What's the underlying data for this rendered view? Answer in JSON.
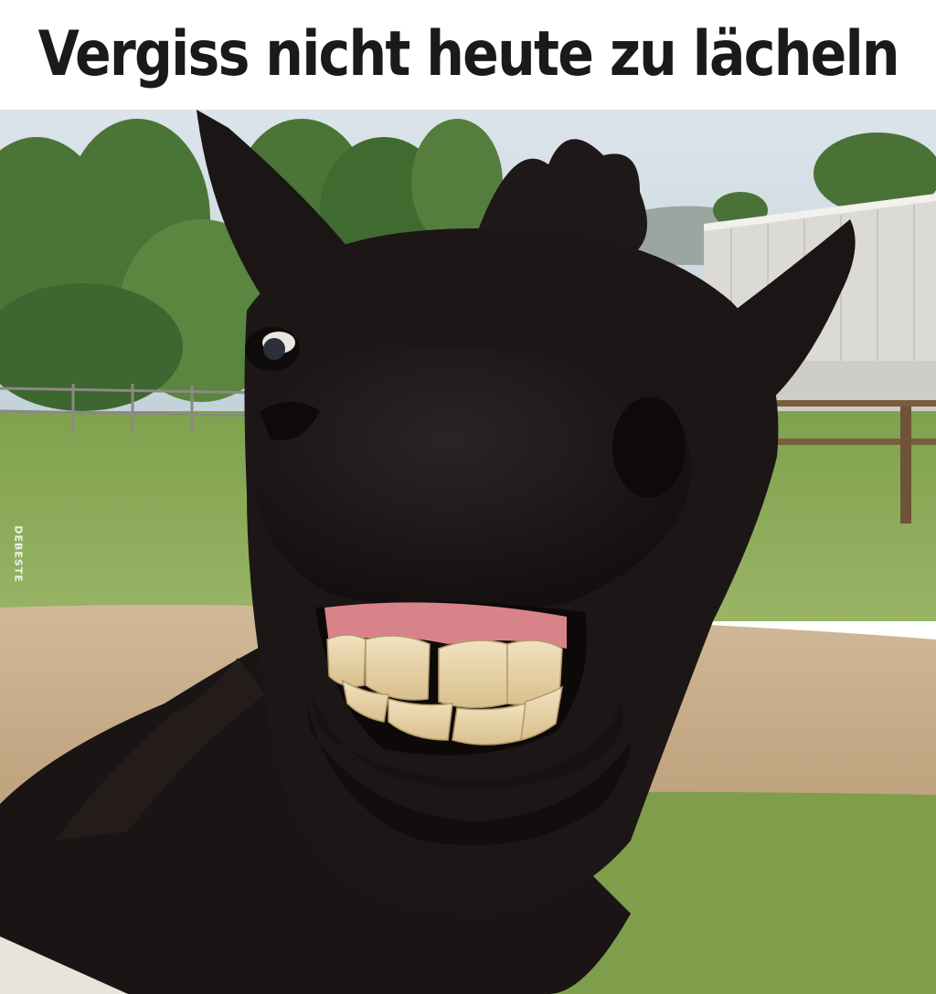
{
  "caption": {
    "text": "Vergiss nicht heute zu lächeln"
  },
  "photo": {
    "subject": "smiling-black-horse",
    "watermark": "DEBESTE"
  },
  "colors": {
    "sky": "#cfdbe3",
    "trees": "#4f7a3a",
    "grass": "#8aa858",
    "dirt": "#c9b090",
    "horse": "#1c1616",
    "teeth": "#e8d3a6",
    "gums": "#d8838a",
    "barn": "#dcdad6"
  }
}
